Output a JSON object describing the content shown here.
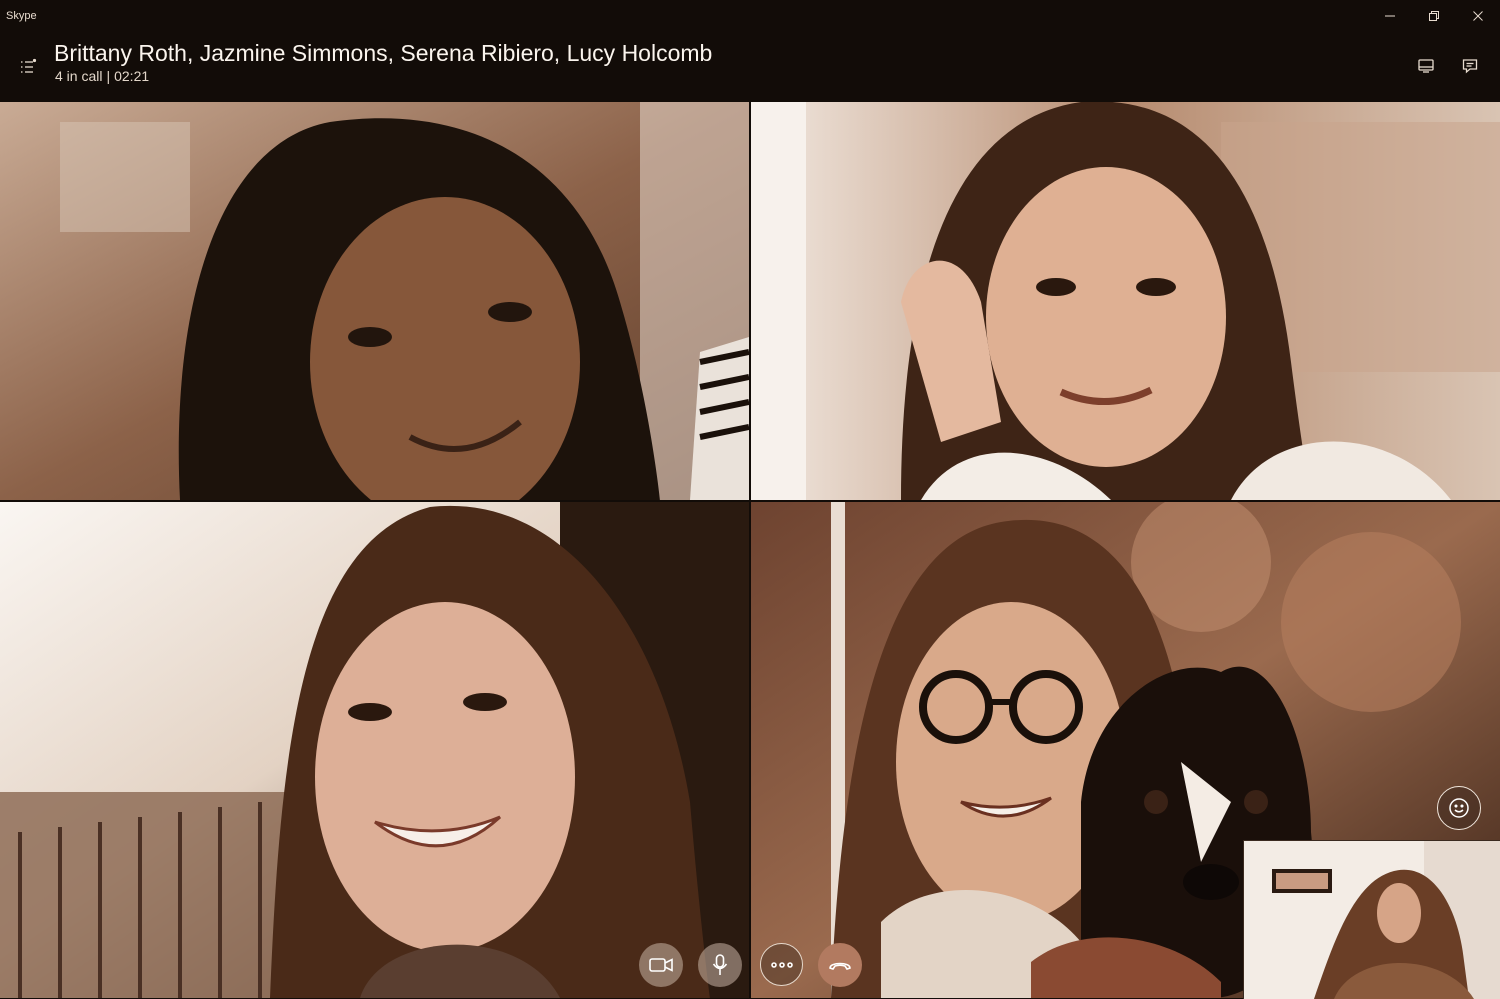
{
  "window": {
    "app_name": "Skype",
    "controls": [
      "minimize",
      "restore",
      "close"
    ]
  },
  "call": {
    "title": "Brittany Roth, Jazmine Simmons, Serena Ribiero, Lucy Holcomb",
    "participants_status": "4 in call",
    "separator": "|",
    "duration": "02:21"
  },
  "header_icons": {
    "menu": "list-menu-icon",
    "call_layout": "screen-layout-icon",
    "chat": "chat-icon"
  },
  "participants": [
    {
      "tile": "video-tile-1",
      "skin": "#8a5a3c",
      "hair": "#1e130c",
      "bg": "#a77e63"
    },
    {
      "tile": "video-tile-2",
      "skin": "#e2b599",
      "hair": "#4a2a18",
      "bg": "#d8c2b0"
    },
    {
      "tile": "video-tile-3",
      "skin": "#e0b29a",
      "hair": "#3e2416",
      "bg": "#efe6dc"
    },
    {
      "tile": "video-tile-4",
      "skin": "#dcaa8c",
      "hair": "#5a3420",
      "bg": "#7a4a32"
    }
  ],
  "controls": {
    "video": "video-camera-icon",
    "mic": "microphone-icon",
    "more": "more-options-icon",
    "end_call": "hang-up-icon",
    "reactions": "smiley-icon"
  },
  "colors": {
    "header_bg": "#120c08",
    "end_call": "#b27a60",
    "text_primary": "#fbf5ee",
    "sepia_tint": "#a9795d"
  }
}
